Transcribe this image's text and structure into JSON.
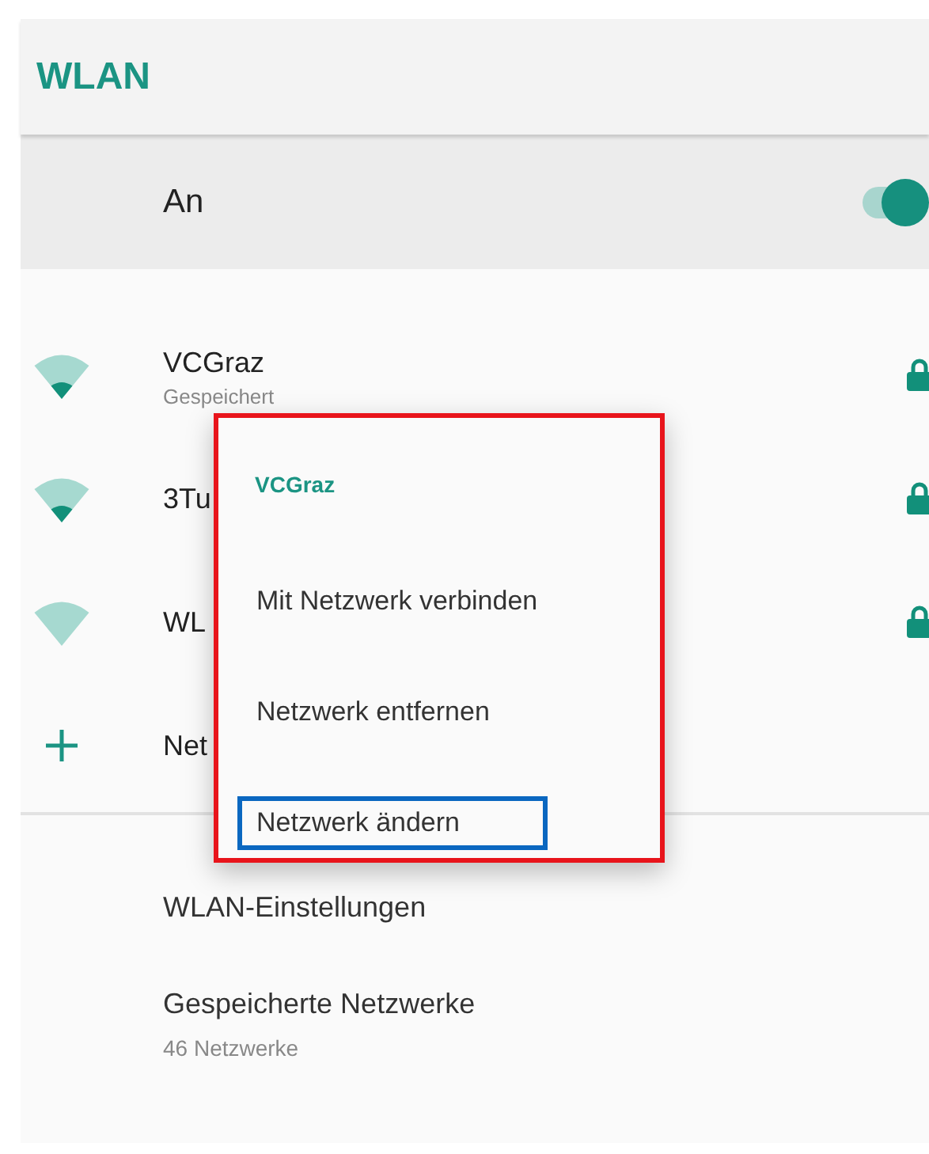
{
  "app_bar": {
    "title": "WLAN"
  },
  "master_switch": {
    "label": "An",
    "on": true
  },
  "networks": [
    {
      "kind": "wifi-weak",
      "name": "VCGraz",
      "status": "Gespeichert",
      "locked": true
    },
    {
      "kind": "wifi-weak",
      "name": "3Tu",
      "locked": true
    },
    {
      "kind": "wifi-none",
      "name": "WL",
      "locked": true
    },
    {
      "kind": "add",
      "name": "Net"
    }
  ],
  "settings": [
    {
      "title": "WLAN-Einstellungen"
    },
    {
      "title": "Gespeicherte Netzwerke",
      "subtitle": "46 Netzwerke"
    }
  ],
  "context_menu": {
    "title": "VCGraz",
    "outlined": true,
    "items": [
      {
        "label": "Mit Netzwerk verbinden",
        "outlined": false
      },
      {
        "label": "Netzwerk entfernen",
        "outlined": false
      },
      {
        "label": "Netzwerk ändern",
        "outlined": true
      }
    ]
  }
}
